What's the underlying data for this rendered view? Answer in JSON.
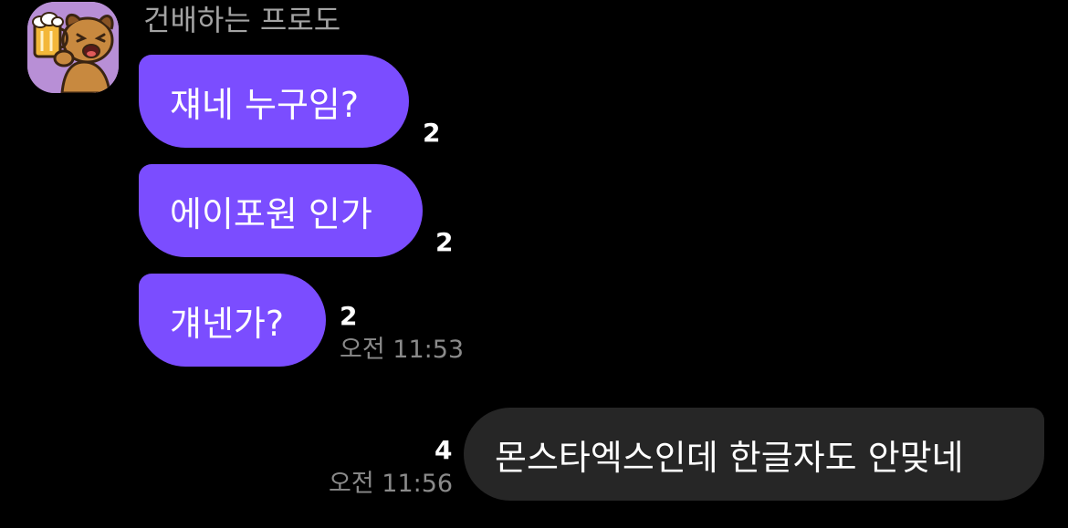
{
  "sender": {
    "name": "건배하는 프로도"
  },
  "messages": [
    {
      "text": "쟤네 누구임?",
      "unread": "2"
    },
    {
      "text": "에이포원 인가",
      "unread": "2"
    },
    {
      "text": "걔넨가?",
      "unread": "2",
      "time": "오전 11:53"
    },
    {
      "text": "몬스타엑스인데 한글자도 안맞네",
      "unread": "4",
      "time": "오전 11:56"
    }
  ],
  "colors": {
    "background": "#000000",
    "incoming_bubble": "#7b4dff",
    "outgoing_bubble": "#262626",
    "avatar_bg": "#b88fd6"
  }
}
